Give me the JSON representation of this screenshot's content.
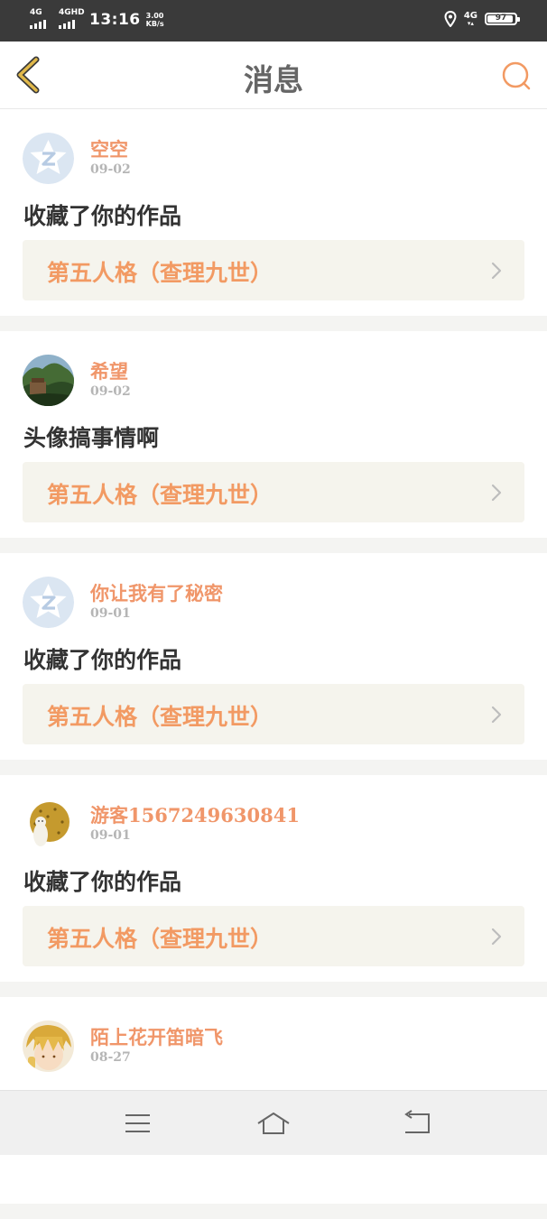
{
  "status_bar": {
    "sim1": "4G",
    "sim2": "4GHD",
    "time": "13:16",
    "speed_value": "3.00",
    "speed_unit": "KB/s",
    "network": "4G",
    "battery": "97"
  },
  "header": {
    "title": "消息",
    "back_icon": "chevron-left-icon",
    "search_icon": "search-icon"
  },
  "messages": [
    {
      "user": "空空",
      "date": "09-02",
      "action": "收藏了你的作品",
      "work": "第五人格（查理九世）",
      "avatar": "default-qq-avatar"
    },
    {
      "user": "希望",
      "date": "09-02",
      "action": "头像搞事情啊",
      "work": "第五人格（查理九世）",
      "avatar": "landscape-avatar"
    },
    {
      "user": "你让我有了秘密",
      "date": "09-01",
      "action": "收藏了你的作品",
      "work": "第五人格（查理九世）",
      "avatar": "default-qq-avatar"
    },
    {
      "user": "游客1567249630841",
      "date": "09-01",
      "action": "收藏了你的作品",
      "work": "第五人格（查理九世）",
      "avatar": "cat-avatar"
    },
    {
      "user": "陌上花开笛暗飞",
      "date": "08-27",
      "action": "",
      "work": "",
      "avatar": "anime-avatar"
    }
  ],
  "colors": {
    "accent": "#f29a63",
    "username": "#f0966a",
    "card_link_bg": "#f5f4ed",
    "back_icon": "#e0b84a"
  },
  "bottom_nav": [
    "menu-icon",
    "home-icon",
    "back-icon"
  ]
}
